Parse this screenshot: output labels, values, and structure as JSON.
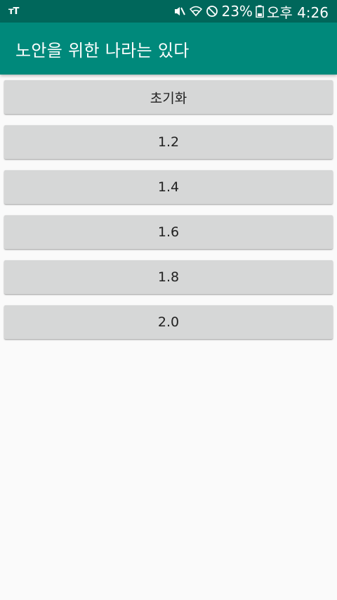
{
  "status_bar": {
    "left_icon_text": "ᴛT",
    "icons": [
      "mute-vibrate-icon",
      "wifi-icon",
      "do-not-disturb-icon"
    ],
    "battery_percent": "23%",
    "time": "오후 4:26"
  },
  "app_bar": {
    "title": "노안을 위한 나라는 있다"
  },
  "buttons": [
    {
      "label": "초기화"
    },
    {
      "label": "1.2"
    },
    {
      "label": "1.4"
    },
    {
      "label": "1.6"
    },
    {
      "label": "1.8"
    },
    {
      "label": "2.0"
    }
  ],
  "colors": {
    "status_bar": "#00675b",
    "app_bar": "#00897b",
    "button_bg": "#d6d7d7",
    "background": "#fafafa"
  }
}
